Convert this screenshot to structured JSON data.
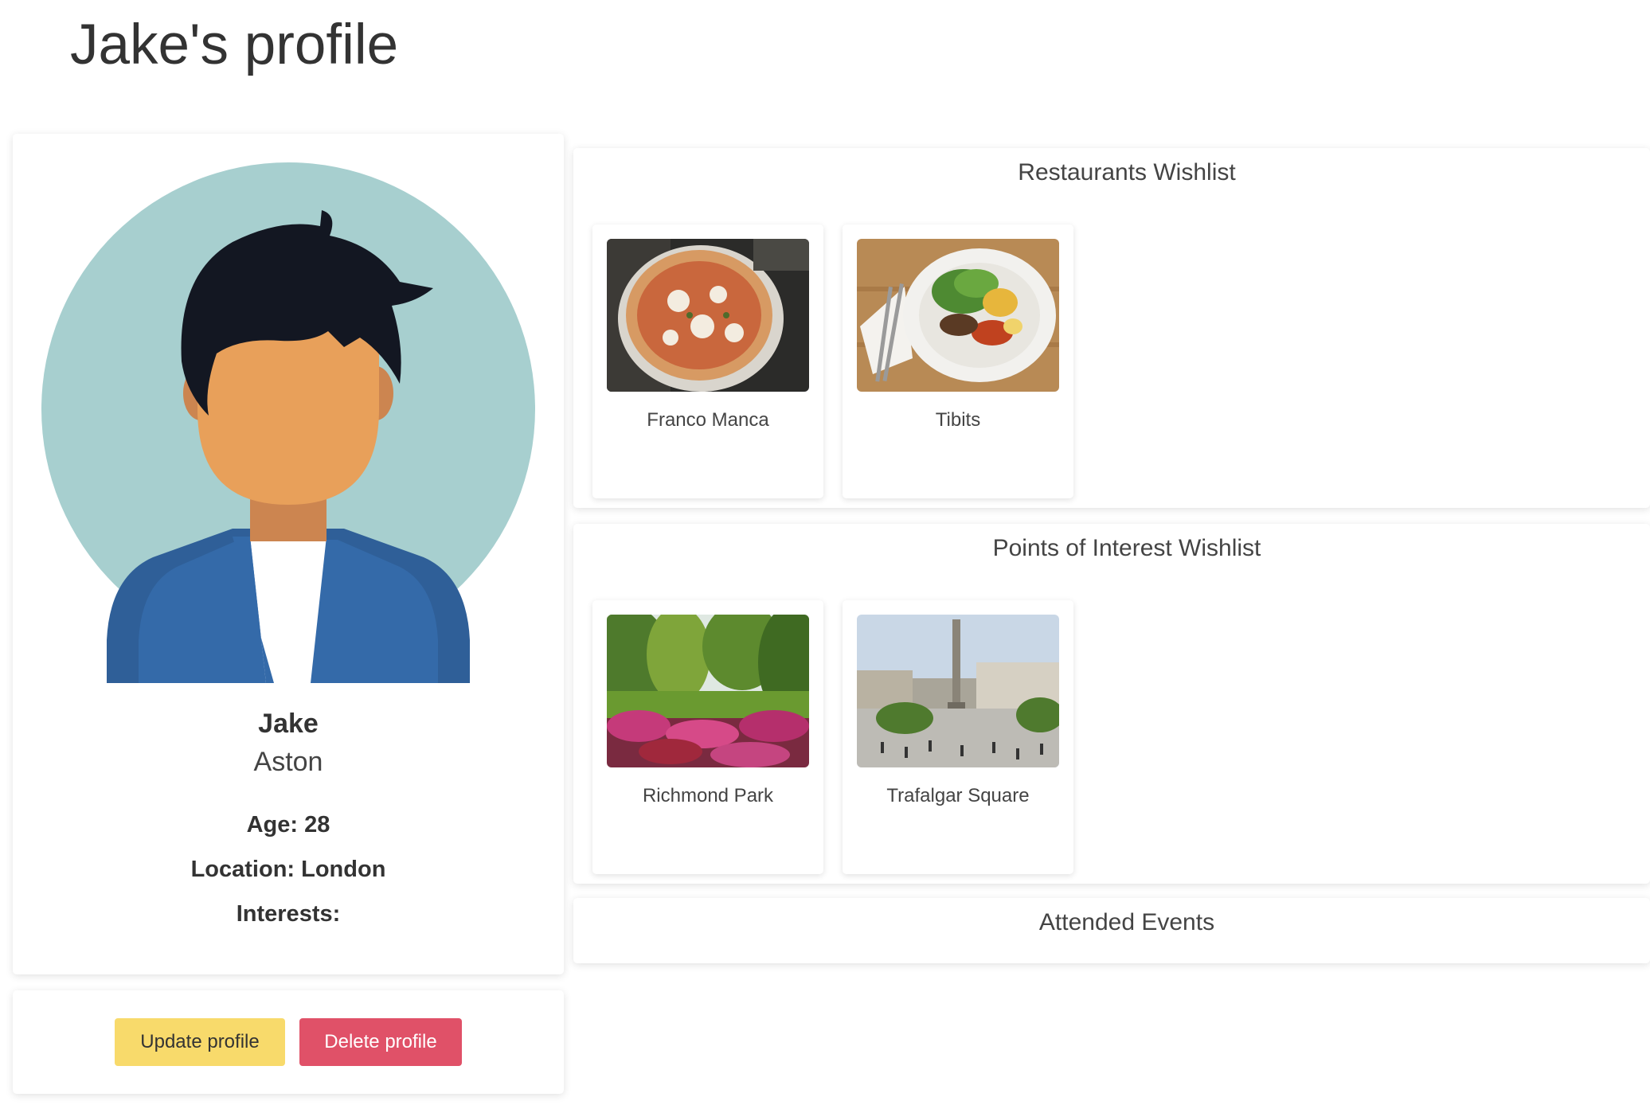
{
  "page": {
    "title": "Jake's profile"
  },
  "profile": {
    "first_name": "Jake",
    "last_name": "Aston",
    "age": "Age: 28",
    "location": "Location: London",
    "interests": "Interests:"
  },
  "actions": {
    "update_label": "Update profile",
    "delete_label": "Delete profile"
  },
  "restaurants": {
    "title": "Restaurants Wishlist",
    "items": [
      {
        "name": "Franco Manca"
      },
      {
        "name": "Tibits"
      }
    ]
  },
  "points_of_interest": {
    "title": "Points of Interest Wishlist",
    "items": [
      {
        "name": "Richmond Park"
      },
      {
        "name": "Trafalgar Square"
      }
    ]
  },
  "events": {
    "title": "Attended Events"
  },
  "colors": {
    "update_button": "#f8da6b",
    "delete_button": "#e05168",
    "avatar_bg": "#a7cfcf",
    "jacket": "#346aa9",
    "skin": "#e8a05a",
    "hair": "#131722"
  }
}
